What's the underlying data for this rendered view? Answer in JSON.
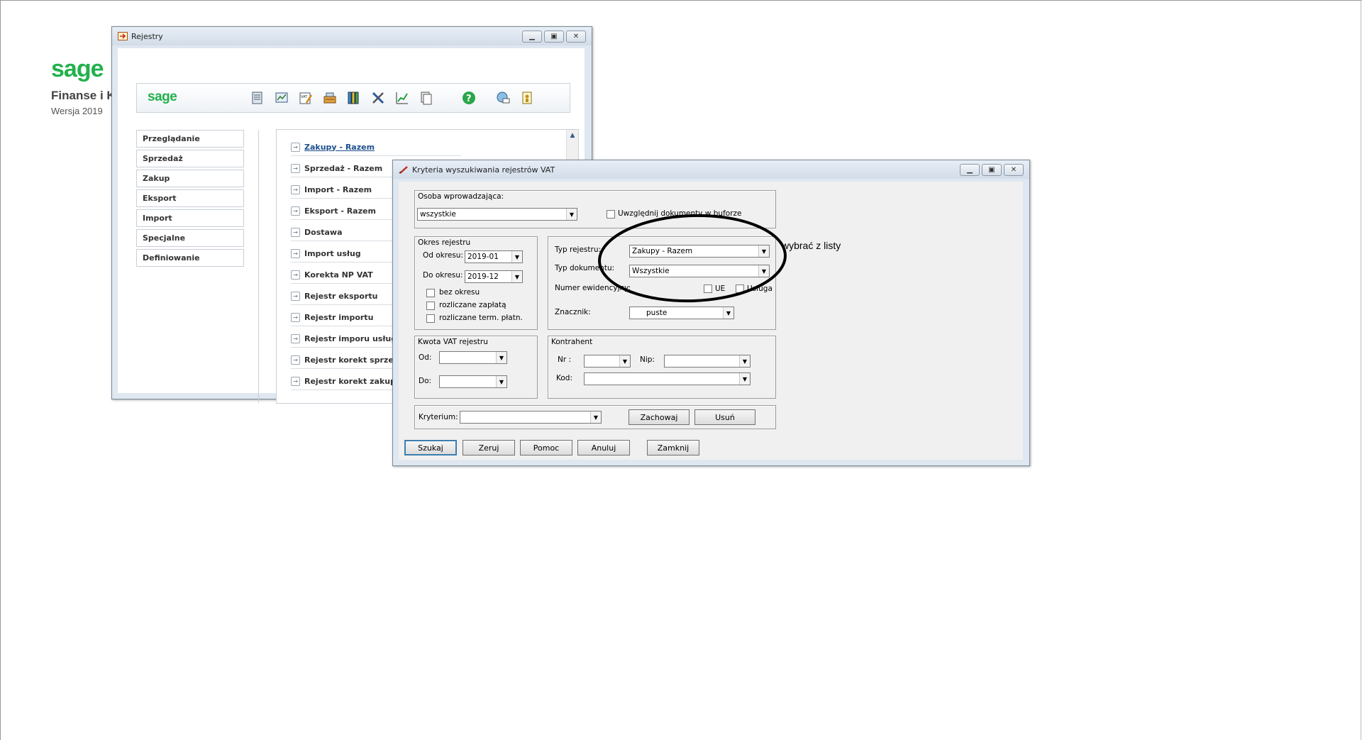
{
  "brand": {
    "logo": "sage",
    "product_name": "Finanse i K",
    "version": "Wersja 2019"
  },
  "window_rejestry": {
    "title": "Rejestry",
    "toolbar_logo": "sage",
    "toolbar_icons": [
      "registers-icon",
      "chart-icon",
      "vat-edit-icon",
      "cash-register-icon",
      "binders-icon",
      "tools-icon",
      "graph-icon",
      "documents-icon",
      "help-icon",
      "globe-mail-icon",
      "user-info-icon"
    ],
    "nav": [
      "Przeglądanie",
      "Sprzedaż",
      "Zakup",
      "Eksport",
      "Import",
      "Specjalne",
      "Definiowanie"
    ],
    "list": [
      "Zakupy - Razem",
      "Sprzedaż - Razem",
      "Import - Razem",
      "Eksport - Razem",
      "Dostawa",
      "Import usług",
      "Korekta NP VAT",
      "Rejestr eksportu",
      "Rejestr importu",
      "Rejestr imporu usług",
      "Rejestr korekt sprzedaży",
      "Rejestr korekt zakupu"
    ]
  },
  "dialog": {
    "title": "Kryteria wyszukiwania rejestrów VAT",
    "osoba_label": "Osoba wprowadzająca:",
    "osoba_value": "wszystkie",
    "bufor_label": "Uwzględnij dokumenty w buforze",
    "okres": {
      "title": "Okres rejestru",
      "od_label": "Od okresu:",
      "od_value": "2019-01",
      "do_label": "Do okresu:",
      "do_value": "2019-12",
      "checks": [
        "bez okresu",
        "rozliczane zapłatą",
        "rozliczane term. płatn."
      ]
    },
    "typ": {
      "typ_rejestru_label": "Typ rejestru:",
      "typ_rejestru_value": "Zakupy - Razem",
      "typ_dokumentu_label": "Typ dokumentu:",
      "typ_dokumentu_value": "Wszystkie",
      "numer_label": "Numer ewidencyjny:",
      "ue_label": "UE",
      "usluga_label": "Usługa",
      "znacznik_label": "Znacznik:",
      "znacznik_value": "puste"
    },
    "kwota": {
      "title": "Kwota VAT rejestru",
      "od_label": "Od:",
      "do_label": "Do:"
    },
    "kontrahent": {
      "title": "Kontrahent",
      "nr_label": "Nr :",
      "nip_label": "Nip:",
      "kod_label": "Kod:"
    },
    "kryterium_label": "Kryterium:",
    "zachowaj": "Zachowaj",
    "usun": "Usuń",
    "buttons": [
      "Szukaj",
      "Zeruj",
      "Pomoc",
      "Anuluj",
      "Zamknij"
    ]
  },
  "annotation": "wybrać z listy",
  "colors": {
    "sage_green": "#22b14c",
    "link_blue": "#1c4f8c"
  }
}
